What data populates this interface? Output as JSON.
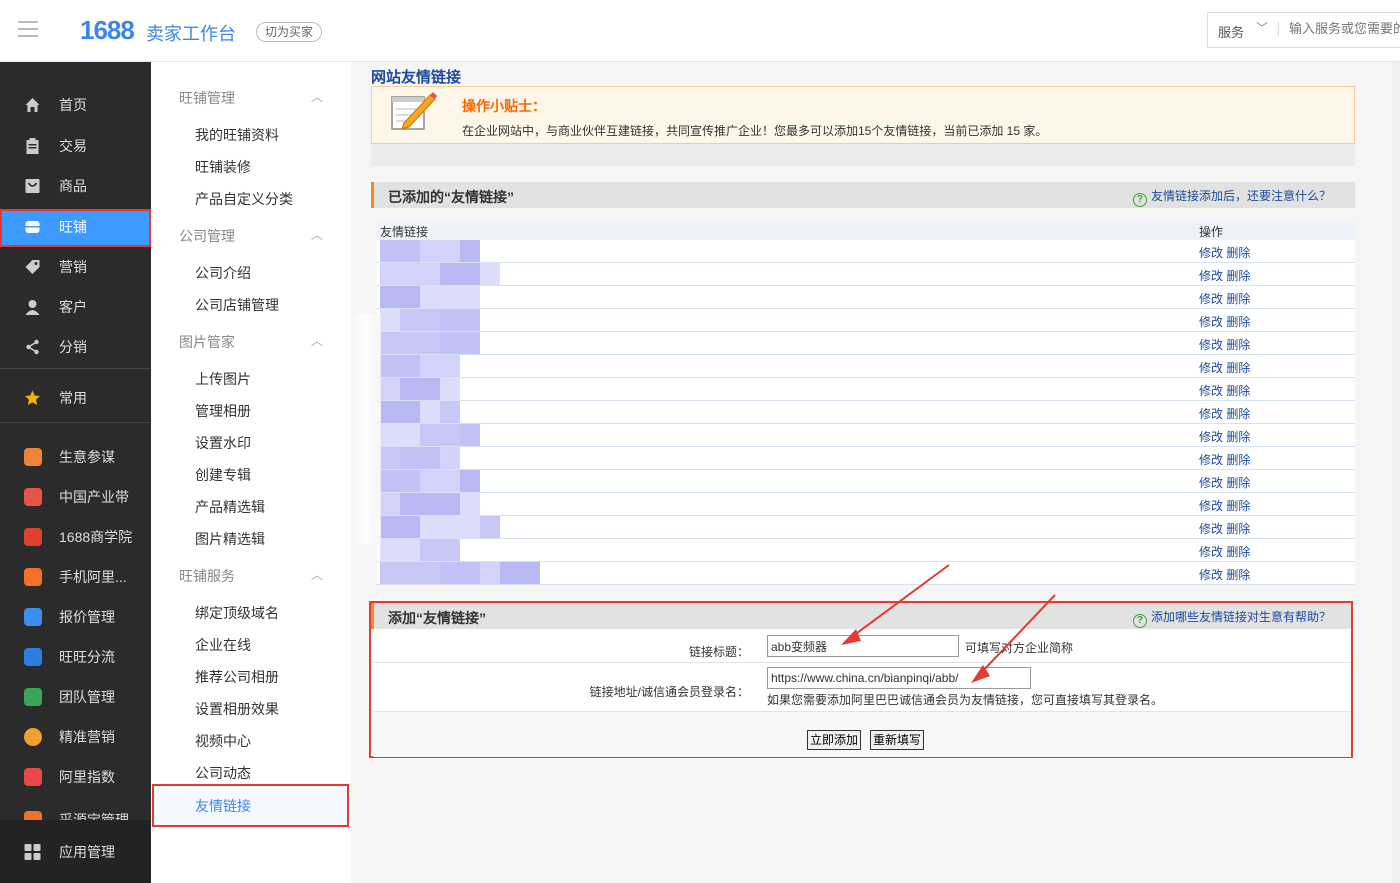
{
  "header": {
    "logo": "1688",
    "app_title": "卖家工作台",
    "switch_label": "切为买家",
    "service_label": "服务",
    "search_placeholder": "输入服务或您需要的"
  },
  "leftnav": {
    "items": [
      {
        "label": "首页",
        "icon": "home-icon"
      },
      {
        "label": "交易",
        "icon": "clipboard-icon"
      },
      {
        "label": "商品",
        "icon": "box-icon"
      },
      {
        "label": "旺铺",
        "icon": "shop-icon"
      },
      {
        "label": "营销",
        "icon": "tag-icon"
      },
      {
        "label": "客户",
        "icon": "user-icon"
      },
      {
        "label": "分销",
        "icon": "share-icon"
      }
    ],
    "common": "常用",
    "tools": [
      {
        "label": "生意参谋",
        "color": "#f0833a"
      },
      {
        "label": "中国产业带",
        "color": "#e8534a"
      },
      {
        "label": "1688商学院",
        "color": "#e0402f"
      },
      {
        "label": "手机阿里...",
        "color": "#f07128"
      },
      {
        "label": "报价管理",
        "color": "#3c8df0"
      },
      {
        "label": "旺旺分流",
        "color": "#2d7de0"
      },
      {
        "label": "团队管理",
        "color": "#3aa65a"
      },
      {
        "label": "精准营销",
        "color": "#f0a030"
      },
      {
        "label": "阿里指数",
        "color": "#e84848"
      },
      {
        "label": "采源宝管理",
        "color": "#f07128"
      }
    ],
    "app_manage": "应用管理"
  },
  "subnav": {
    "groups": [
      {
        "title": "旺铺管理",
        "items": [
          "我的旺铺资料",
          "旺铺装修",
          "产品自定义分类"
        ]
      },
      {
        "title": "公司管理",
        "items": [
          "公司介绍",
          "公司店铺管理"
        ]
      },
      {
        "title": "图片管家",
        "items": [
          "上传图片",
          "管理相册",
          "设置水印",
          "创建专辑",
          "产品精选辑",
          "图片精选辑"
        ]
      },
      {
        "title": "旺铺服务",
        "items": [
          "绑定顶级域名",
          "企业在线",
          "推荐公司相册",
          "设置相册效果",
          "视频中心",
          "公司动态",
          "友情链接"
        ]
      }
    ]
  },
  "main": {
    "page_title": "网站友情链接",
    "tips_title": "操作小贴士：",
    "tips_text": "在企业网站中，与商业伙伴互建链接，共同宣传推广企业！您最多可以添加15个友情链接，当前已添加 15 家。",
    "added_title": "已添加的“友情链接”",
    "added_help": "友情链接添加后，还要注意什么？",
    "col_link": "友情链接",
    "col_op": "操作",
    "edit_label": "修改",
    "delete_label": "删除",
    "add_title": "添加“友情链接”",
    "add_help": "添加哪些友情链接对生意有帮助？",
    "title_label": "链接标题：",
    "title_value": "abb变频器",
    "title_hint": "可填写对方企业简称",
    "url_label": "链接地址/诚信通会员登录名：",
    "url_value": "https://www.china.cn/bianpinqi/abb/",
    "url_hint": "如果您需要添加阿里巴巴诚信通会员为友情链接，您可直接填写其登录名。",
    "submit_label": "立即添加",
    "reset_label": "重新填写"
  },
  "colors": {
    "accent": "#3d9bff",
    "highlight": "#e53935",
    "tips_title": "#ff6600",
    "link": "#1e4a9b"
  }
}
